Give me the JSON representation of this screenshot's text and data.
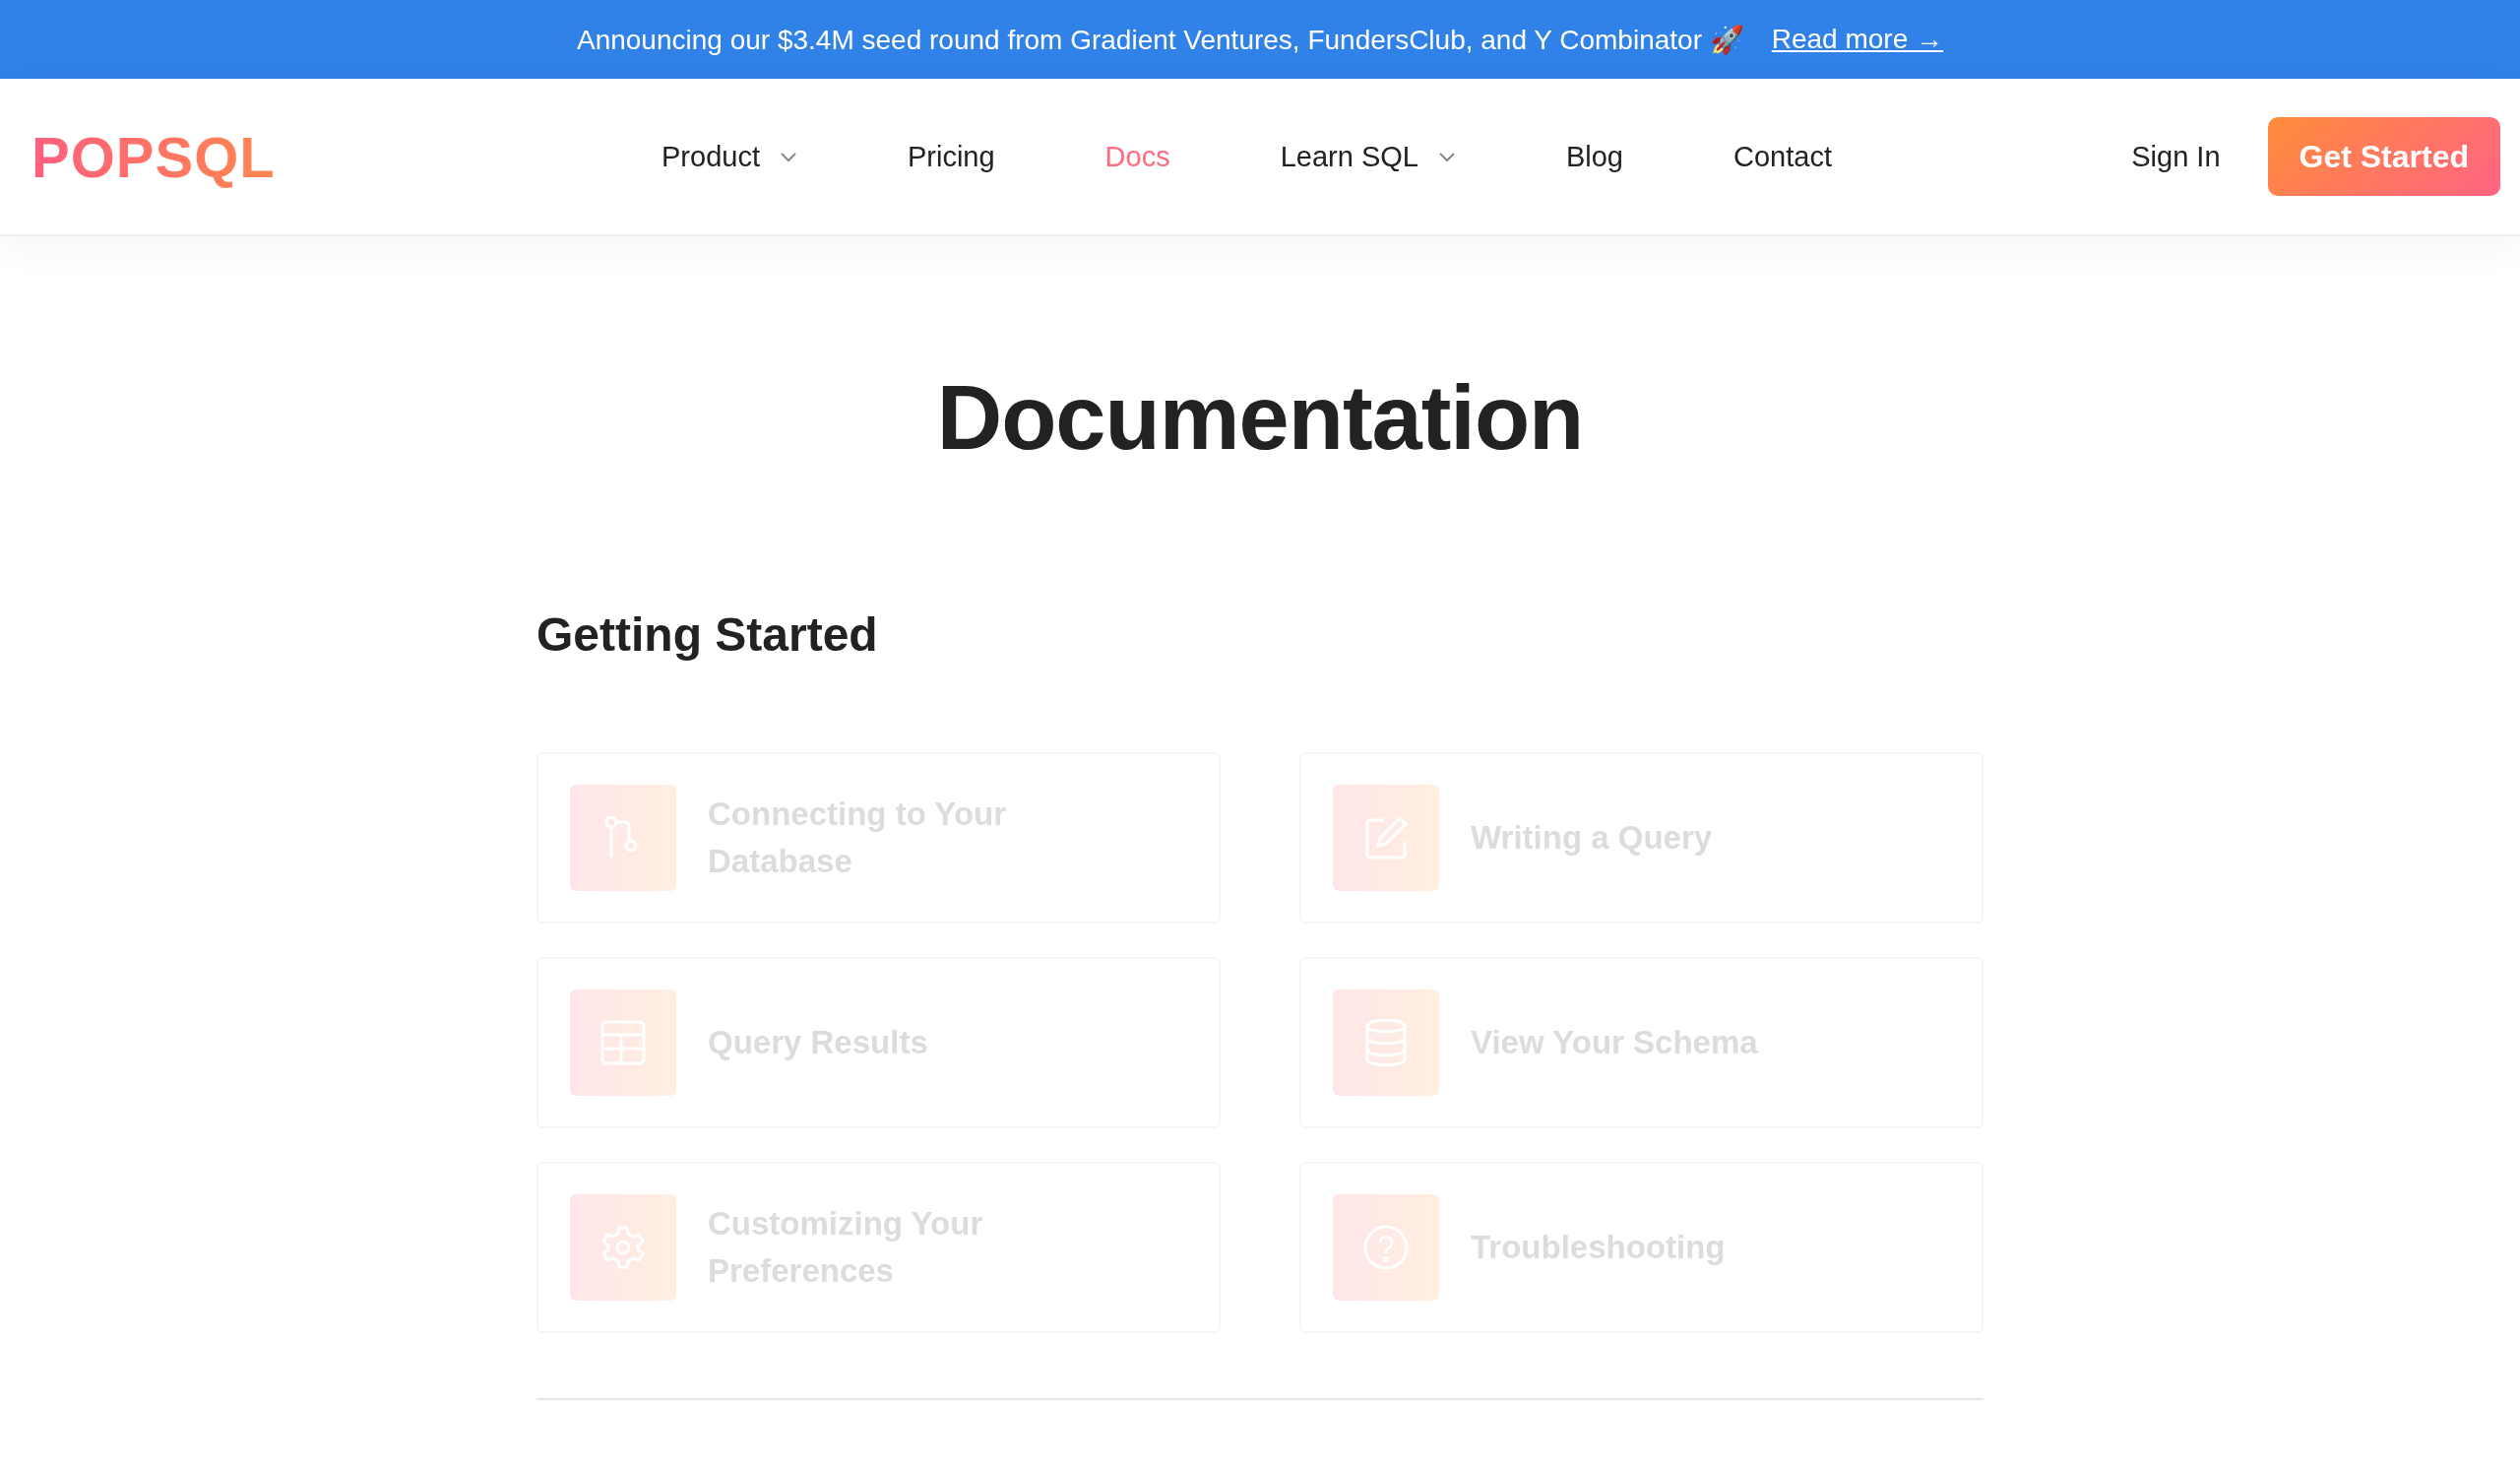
{
  "banner": {
    "text": "Announcing our $3.4M seed round from Gradient Ventures, FundersClub, and Y Combinator 🚀",
    "link": "Read more →"
  },
  "header": {
    "logo": "POPSQL",
    "nav": [
      {
        "label": "Product",
        "selected": false,
        "has_dropdown": true
      },
      {
        "label": "Pricing",
        "selected": false,
        "has_dropdown": false
      },
      {
        "label": "Docs",
        "selected": true,
        "has_dropdown": false
      },
      {
        "label": "Learn SQL",
        "selected": false,
        "has_dropdown": true
      },
      {
        "label": "Blog",
        "selected": false,
        "has_dropdown": false
      },
      {
        "label": "Contact",
        "selected": false,
        "has_dropdown": false
      }
    ],
    "sign_in": "Sign In",
    "cta": "Get Started"
  },
  "title": "Documentation",
  "section": {
    "heading": "Getting Started",
    "cards": [
      {
        "kind": "branch",
        "label": "Connecting to Your Database"
      },
      {
        "kind": "edit",
        "label": "Writing a Query"
      },
      {
        "kind": "table",
        "label": "Query Results"
      },
      {
        "kind": "database",
        "label": "View Your Schema"
      },
      {
        "kind": "gear",
        "label": "Customizing Your Preferences"
      },
      {
        "kind": "help",
        "label": "Troubleshooting"
      }
    ]
  }
}
